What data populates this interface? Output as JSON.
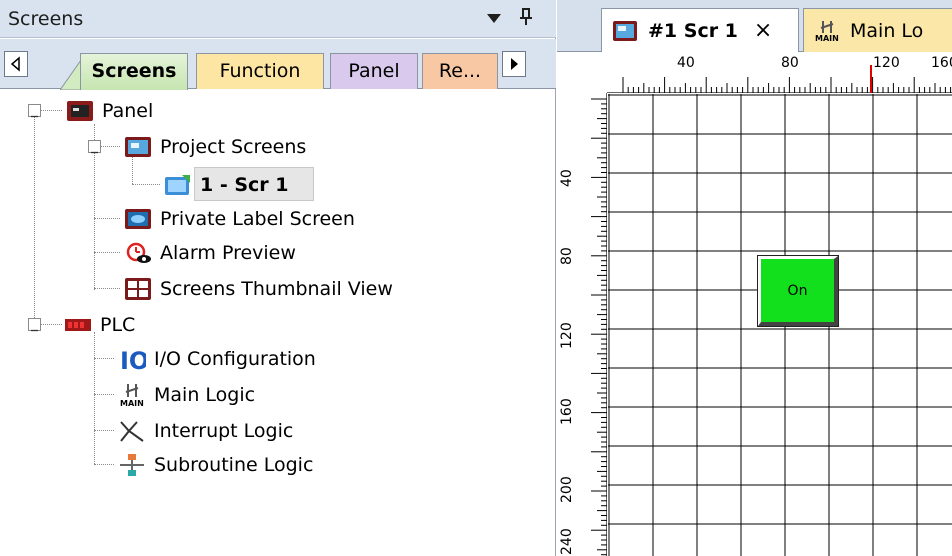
{
  "pane": {
    "title": "Screens",
    "tabs": [
      {
        "label": "Screens",
        "color": "#c6e5b0"
      },
      {
        "label": "Function",
        "color": "#fde5a4"
      },
      {
        "label": "Panel",
        "color": "#d9c9ec"
      },
      {
        "label": "Re...",
        "color": "#f8c7a4"
      }
    ]
  },
  "tree": {
    "panel": "Panel",
    "project_screens": "Project Screens",
    "scr1": "1 - Scr 1",
    "private_label": "Private Label Screen",
    "alarm_preview": "Alarm Preview",
    "thumbnail_view": "Screens Thumbnail View",
    "plc": "PLC",
    "io_config": "I/O Configuration",
    "main_logic": "Main Logic",
    "interrupt_logic": "Interrupt Logic",
    "subroutine_logic": "Subroutine Logic",
    "io_icon_text": "IO",
    "main_icon_text": "MAIN"
  },
  "doc_tabs": {
    "scr1": "#1 Scr 1",
    "close": "×",
    "main": "Main Lo"
  },
  "ruler": {
    "h_labels": [
      "40",
      "80",
      "120",
      "160"
    ],
    "v_labels": [
      "40",
      "80",
      "120",
      "160",
      "200",
      "240"
    ]
  },
  "canvas": {
    "button_label": "On",
    "button_color": "#13e01d"
  }
}
